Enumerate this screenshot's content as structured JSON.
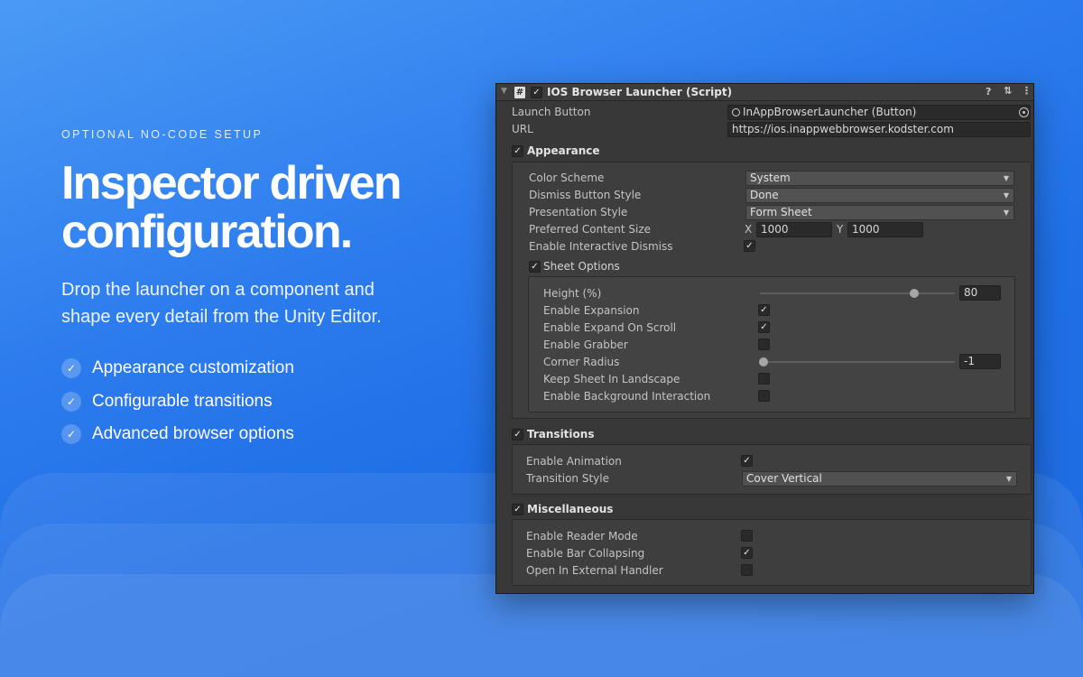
{
  "hero": {
    "eyebrow": "OPTIONAL NO-CODE SETUP",
    "headline_line1": "Inspector driven",
    "headline_line2": "configuration.",
    "lead_line1": "Drop the launcher on a component and",
    "lead_line2": "shape every detail from the Unity Editor.",
    "features": [
      "Appearance customization",
      "Configurable transitions",
      "Advanced browser options"
    ]
  },
  "inspector": {
    "title": "IOS Browser Launcher (Script)",
    "component_enabled": true,
    "launch_button": {
      "label": "Launch Button",
      "value": "InAppBrowserLauncher (Button)"
    },
    "url": {
      "label": "URL",
      "value": "https://ios.inappwebbrowser.kodster.com"
    },
    "appearance": {
      "title": "Appearance",
      "enabled": true,
      "color_scheme": {
        "label": "Color Scheme",
        "value": "System"
      },
      "dismiss_button_style": {
        "label": "Dismiss Button Style",
        "value": "Done"
      },
      "presentation_style": {
        "label": "Presentation Style",
        "value": "Form Sheet"
      },
      "preferred_content_size": {
        "label": "Preferred Content Size",
        "x_label": "X",
        "x": "1000",
        "y_label": "Y",
        "y": "1000"
      },
      "enable_interactive_dismiss": {
        "label": "Enable Interactive Dismiss",
        "checked": true
      },
      "sheet_options": {
        "title": "Sheet Options",
        "enabled": true,
        "height": {
          "label": "Height (%)",
          "value": "80",
          "fraction": 0.8
        },
        "enable_expansion": {
          "label": "Enable Expansion",
          "checked": true
        },
        "enable_expand_on_scroll": {
          "label": "Enable Expand On Scroll",
          "checked": true
        },
        "enable_grabber": {
          "label": "Enable Grabber",
          "checked": false
        },
        "corner_radius": {
          "label": "Corner Radius",
          "value": "-1",
          "fraction": 0
        },
        "keep_sheet_in_landscape": {
          "label": "Keep Sheet In Landscape",
          "checked": false
        },
        "enable_background_interaction": {
          "label": "Enable Background Interaction",
          "checked": false
        }
      }
    },
    "transitions": {
      "title": "Transitions",
      "enabled": true,
      "enable_animation": {
        "label": "Enable Animation",
        "checked": true
      },
      "transition_style": {
        "label": "Transition Style",
        "value": "Cover Vertical"
      }
    },
    "miscellaneous": {
      "title": "Miscellaneous",
      "enabled": true,
      "enable_reader_mode": {
        "label": "Enable Reader Mode",
        "checked": false
      },
      "enable_bar_collapsing": {
        "label": "Enable Bar Collapsing",
        "checked": true
      },
      "open_in_external_handler": {
        "label": "Open In External Handler",
        "checked": false
      }
    },
    "icons": {
      "help": "help-icon",
      "presets": "presets-icon",
      "menu": "kebab-menu-icon",
      "script": "script-icon"
    }
  },
  "colors": {
    "background": "#2d7cee",
    "panel": "#383838",
    "field": "#2a2a2a",
    "dropdown": "#515151"
  }
}
